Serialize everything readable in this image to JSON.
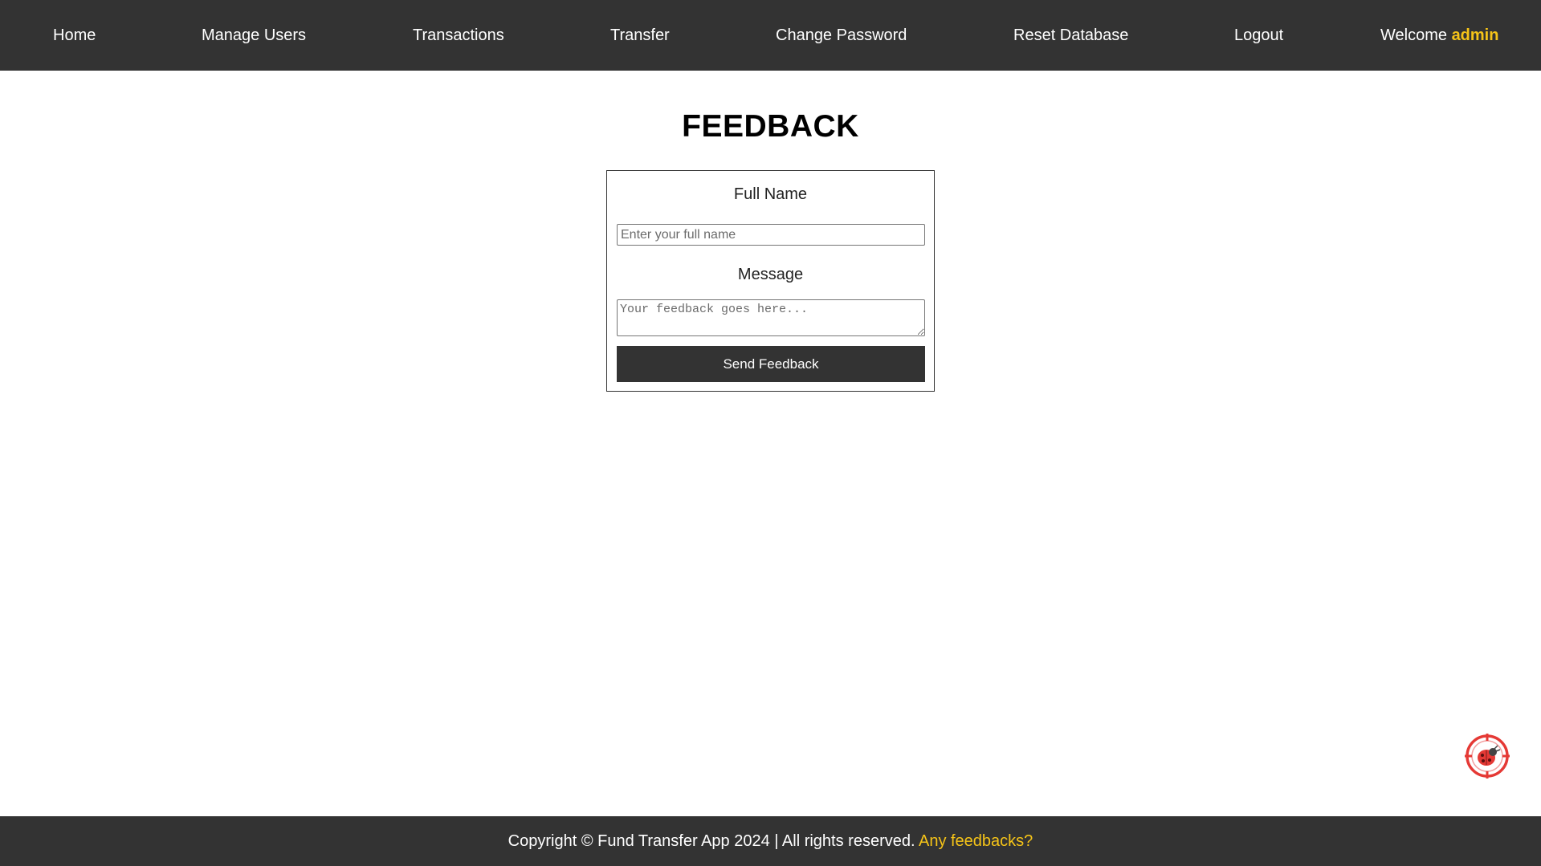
{
  "nav": {
    "home": "Home",
    "manage_users": "Manage Users",
    "transactions": "Transactions",
    "transfer": "Transfer",
    "change_password": "Change Password",
    "reset_database": "Reset Database",
    "logout": "Logout",
    "welcome_prefix": "Welcome",
    "welcome_user": "admin"
  },
  "page_title": "FEEDBACK",
  "form": {
    "full_name_label": "Full Name",
    "full_name_placeholder": "Enter your full name",
    "full_name_value": "",
    "message_label": "Message",
    "message_placeholder": "Your feedback goes here...",
    "message_value": "",
    "send_label": "Send Feedback"
  },
  "footer": {
    "copyright": "Copyright © Fund Transfer App 2024 | All rights reserved.",
    "feedback_link": "Any feedbacks?"
  },
  "colors": {
    "nav_background": "#333333",
    "accent": "#f6c418",
    "button_background": "#333333",
    "bug_widget": "#e53935"
  },
  "icons": {
    "bug_widget": "ladybug-target-icon"
  }
}
